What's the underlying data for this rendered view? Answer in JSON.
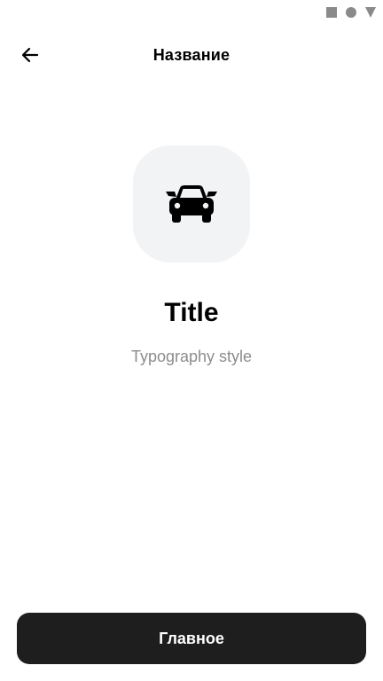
{
  "status_bar": {
    "icons": [
      "square-icon",
      "circle-icon",
      "triangle-icon"
    ],
    "icon_color": "#8a8a8a"
  },
  "app_bar": {
    "title": "Название",
    "back_icon": "arrow-left-icon"
  },
  "content": {
    "icon": "car-icon",
    "tile_color": "#f2f3f5",
    "title": "Title",
    "subtitle": "Typography style",
    "subtitle_color": "#8c8c8c"
  },
  "primary_button": {
    "label": "Главное",
    "background": "#1e1e1e"
  }
}
